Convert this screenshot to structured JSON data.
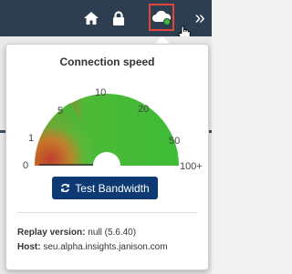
{
  "colors": {
    "topbar": "#2c3e50",
    "highlight": "#e0453a",
    "button": "#0d3a72",
    "gauge_green": "#3dbb37",
    "gauge_red": "#c0392b"
  },
  "toolbar": {
    "icons": [
      "home-icon",
      "lock-icon",
      "cloud-icon",
      "chevron-double-right-icon"
    ],
    "more_label": "»"
  },
  "popup": {
    "title": "Connection speed",
    "gauge": {
      "scale_labels": [
        "0",
        "1",
        "5",
        "10",
        "20",
        "50",
        "100+"
      ],
      "needle_value": "0"
    },
    "button_label": "Test Bandwidth",
    "replay_label": "Replay version:",
    "replay_value": "null (5.6.40)",
    "host_label": "Host:",
    "host_value": "seu.alpha.insights.janison.com"
  }
}
